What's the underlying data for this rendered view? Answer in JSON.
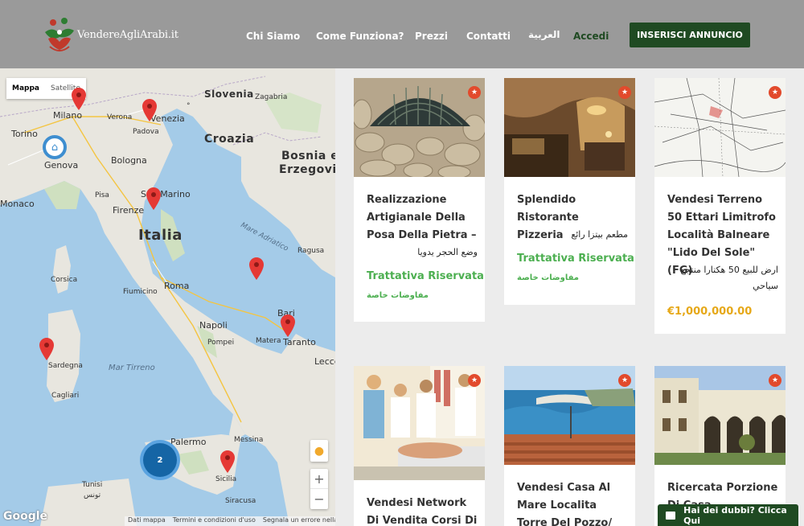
{
  "header": {
    "brand": "VendereAgliArabi.it",
    "nav": [
      "Chi Siamo",
      "Come Funziona?",
      "Prezzi",
      "Contatti",
      "العربية"
    ],
    "login": "Accedi",
    "cta": "INSERISCI ANNUNCIO"
  },
  "map": {
    "type_options": [
      "Mappa",
      "Satellite"
    ],
    "labels": {
      "milano": "Milano",
      "venezia": "Venezia",
      "verona": "Verona",
      "padova": "Padova",
      "torino": "Torino",
      "genova": "Genova",
      "bologna": "Bologna",
      "pisa": "Pisa",
      "firenze": "Firenze",
      "san_marino": "San Marino",
      "monaco": "Monaco",
      "italia": "Italia",
      "corsica": "Corsica",
      "roma": "Roma",
      "fiumicino": "Fiumicino",
      "napoli": "Napoli",
      "bari": "Bari",
      "taranto": "Taranto",
      "matera": "Matera",
      "pompei": "Pompei",
      "lecce": "Lecce",
      "sardegna": "Sardegna",
      "cagliari": "Cagliari",
      "mar_tirreno": "Mar Tirreno",
      "mare_adriatico": "Mare Adriatico",
      "palermo": "Palermo",
      "messina": "Messina",
      "sicilia": "Sicilia",
      "siracusa": "Siracusa",
      "tunisi": "Tunisi",
      "tunisi_ar": "تونس",
      "slovenia": "Slovenia",
      "zagabria": "Zagabria",
      "croazia": "Croazia",
      "bosnia": "Bosnia e",
      "erzegovina": "Erzegovina",
      "ragusa": "Ragusa"
    },
    "cluster_count": "2",
    "zoom_in": "+",
    "zoom_out": "−",
    "google": "Google",
    "attribution": [
      "Dati mappa",
      "Termini e condizioni d'uso",
      "Segnala un errore nella mappa"
    ]
  },
  "listings": [
    {
      "title": "Realizzazione Artigianale Della Posa Della Pietra –",
      "arabic": "وضع الحجر يدويا",
      "price": "Trattativa Riservata",
      "price_ar": "مفاوضات خاصة"
    },
    {
      "title": "Splendido Ristorante Pizzeria",
      "arabic": "مطعم بيتزا رائع",
      "price": "Trattativa Riservata",
      "price_ar": "مفاوضات خاصة"
    },
    {
      "title": "Vendesi Terreno 50 Ettari Limitrofo Località Balneare \"Lido Del Sole\" (FG)",
      "arabic": "ارض للبيع 50 هكتارا منتجع سياحي",
      "price": "€1,000,000.00"
    },
    {
      "title": "Vendesi Network Di Vendita Corsi Di"
    },
    {
      "title": "Vendesi Casa Al Mare Localita Torre Del Pozzo/منزل على"
    },
    {
      "title": "Ricercata Porzione Di Casa"
    }
  ],
  "chat": {
    "label": "Hai dei dubbi? Clicca Qui"
  },
  "colors": {
    "brand_green": "#1f4a22",
    "price_green": "#4caf50",
    "price_gold": "#e6a818",
    "star_red": "#e24a2c",
    "map_water": "#a4cbe8"
  }
}
